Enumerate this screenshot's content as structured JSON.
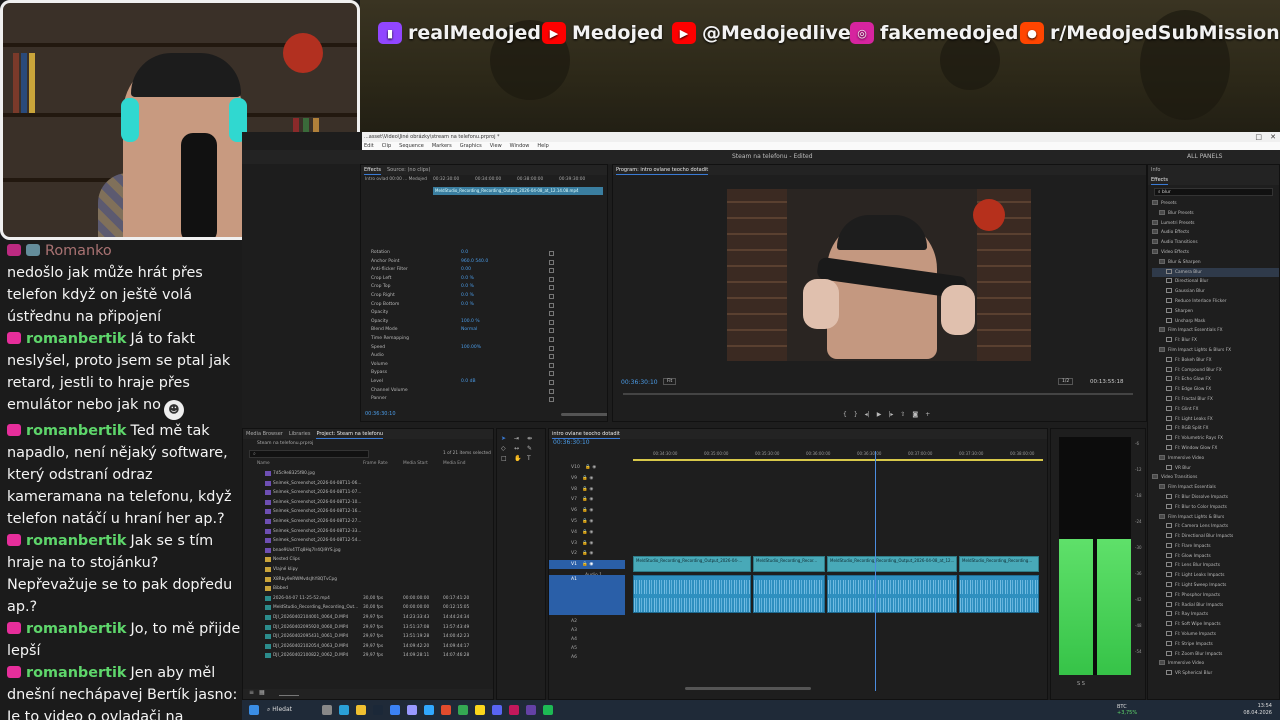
{
  "banner": {
    "socials": [
      {
        "platform": "twitch-icon",
        "label": "realMedojed",
        "color": "#9146ff"
      },
      {
        "platform": "youtube-icon",
        "label": "Medojed",
        "color": "#ff0000"
      },
      {
        "platform": "youtube-icon",
        "label": "@Medojedlive",
        "color": "#ff0000"
      },
      {
        "platform": "instagram-icon",
        "label": "fakemedojed",
        "color": "#d6249f"
      },
      {
        "platform": "reddit-icon",
        "label": "r/MedojedSubMissions",
        "color": "#ff4500"
      }
    ]
  },
  "chat": {
    "messages": [
      {
        "user": "",
        "text": "nedošlo jak může hrát přes telefon když on ještě volá ústřednu na připojení"
      },
      {
        "user": "romanbertik",
        "text": "Já to fakt neslyšel, proto jsem se ptal jak retard, jestli to hraje přes emulátor nebo jak no"
      },
      {
        "user": "romanbertik",
        "text": "Ted mě tak napadlo, není nějaký software, který odstraní odraz kameramana na telefonu, když telefon natáčí u hraní her ap.?"
      },
      {
        "user": "romanbertik",
        "text": "Jak se s tím hraje na to stojánku? Nepřevažuje se to pak dopředu ap.?"
      },
      {
        "user": "romanbertik",
        "text": "Jo, to mě přijde lepší"
      },
      {
        "user": "romanbertik",
        "text": "Jen aby měl dnešní nechápavej Bertík jasno: Je to video o ovladači na telefon, že?"
      }
    ],
    "top_partial_name": "Romanko",
    "emote_labels": [
      "☻",
      "☻"
    ]
  },
  "premiere": {
    "window_title": "...asset\\Video\\Jiné obrázky\\stream na telefonu.prproj *",
    "menu": [
      "Edit",
      "Clip",
      "Sequence",
      "Markers",
      "Graphics",
      "View",
      "Window",
      "Help"
    ],
    "project_title": "Steam na telefonu - Edited",
    "workspace_label": "ALL PANELS",
    "effect_controls": {
      "tabs": [
        "Effects",
        "Source: (no clips)"
      ],
      "source_label": "Intro ovlad 00:00 ... Medojed",
      "clip_label": "MeldStudio_Recording_Recording_Output_2026-04-08_at_12.14.08.mp4",
      "ruler": [
        "00:32:30:00",
        "00:34:00:00",
        "00:38:00:00",
        "00:39:30:00"
      ],
      "properties": [
        {
          "name": "Rotation",
          "value": "0.0"
        },
        {
          "name": "Anchor Point",
          "value": "960.0   540.0"
        },
        {
          "name": "Anti-flicker Filter",
          "value": "0.00"
        },
        {
          "name": "Crop Left",
          "value": "0.0 %"
        },
        {
          "name": "Crop Top",
          "value": "0.0 %"
        },
        {
          "name": "Crop Right",
          "value": "0.0 %"
        },
        {
          "name": "Crop Bottom",
          "value": "0.0 %"
        },
        {
          "name": "Opacity",
          "value": ""
        },
        {
          "name": "Opacity",
          "value": "100.0 %"
        },
        {
          "name": "Blend Mode",
          "value": "Normal"
        },
        {
          "name": "Time Remapping",
          "value": ""
        },
        {
          "name": "Speed",
          "value": "100.00%"
        },
        {
          "name": "Audio",
          "value": ""
        },
        {
          "name": "Volume",
          "value": ""
        },
        {
          "name": "Bypass",
          "value": ""
        },
        {
          "name": "Level",
          "value": "0.0 dB"
        },
        {
          "name": "Channel Volume",
          "value": ""
        },
        {
          "name": "Panner",
          "value": ""
        }
      ],
      "timecode": "00:36:30:10"
    },
    "program": {
      "tab": "Program: intro ovlane teocho dotadit",
      "timecode": "00:36:30:10",
      "zoom": "Fit",
      "resolution": "1/2",
      "duration": "00:13:55:18"
    },
    "project": {
      "tabs": [
        "Media Browser",
        "Libraries",
        "Project: Steam na telefonu"
      ],
      "file_label": "Steam na telefonu.prproj",
      "items_selected": "1 of 21 items selected",
      "columns": [
        "Name",
        "Frame Rate",
        "Media Start",
        "Media End"
      ],
      "rows": [
        {
          "name": "7d5c9e8325f80.jpg",
          "fps": "",
          "start": "",
          "end": ""
        },
        {
          "name": "Snímek_Screenshot_2026-04-08T11-06...",
          "fps": "",
          "start": "",
          "end": ""
        },
        {
          "name": "Snímek_Screenshot_2026-04-08T11-07...",
          "fps": "",
          "start": "",
          "end": ""
        },
        {
          "name": "Snímek_Screenshot_2026-04-08T12-10...",
          "fps": "",
          "start": "",
          "end": ""
        },
        {
          "name": "Snímek_Screenshot_2026-04-08T12-16...",
          "fps": "",
          "start": "",
          "end": ""
        },
        {
          "name": "Snímek_Screenshot_2026-04-08T12-27...",
          "fps": "",
          "start": "",
          "end": ""
        },
        {
          "name": "Snímek_Screenshot_2026-04-08T12-33...",
          "fps": "",
          "start": "",
          "end": ""
        },
        {
          "name": "Snímek_Screenshot_2026-04-08T12-54...",
          "fps": "",
          "start": "",
          "end": ""
        },
        {
          "name": "bnae9Ux4TTq8Hq7Ir4Qi9YS.jpg",
          "fps": "",
          "start": "",
          "end": ""
        },
        {
          "name": "Nested Clips",
          "fps": "",
          "start": "",
          "end": ""
        },
        {
          "name": "Vlajné klipy",
          "fps": "",
          "start": "",
          "end": ""
        },
        {
          "name": "X8Rby9eRWMvdsJhY8QTvCpg",
          "fps": "",
          "start": "",
          "end": ""
        },
        {
          "name": "Bibbed",
          "fps": "",
          "start": "",
          "end": ""
        },
        {
          "name": "2026-04-07 11-25-52.mp4",
          "fps": "30,00 fps",
          "start": "00:00:00:00",
          "end": "00:17:41:20"
        },
        {
          "name": "MeldStudio_Recording_Recording_Out...",
          "fps": "30,00 fps",
          "start": "00:00:00:00",
          "end": "00:12:15:05"
        },
        {
          "name": "DJI_20260402104001_0064_D.MP4",
          "fps": "29,97 fps",
          "start": "14:23:33:43",
          "end": "14:44:24:34"
        },
        {
          "name": "DJI_20260402095920_0060_D.MP4",
          "fps": "29,97 fps",
          "start": "13:51:37:08",
          "end": "13:57:43:49"
        },
        {
          "name": "DJI_20260402095431_0061_D.MP4",
          "fps": "29,97 fps",
          "start": "13:51:19:28",
          "end": "14:00:42:23"
        },
        {
          "name": "DJI_20260402102054_0063_D.MP4",
          "fps": "29,97 fps",
          "start": "14:09:42:20",
          "end": "14:09:44:17"
        },
        {
          "name": "DJI_20260402100822_0062_D.MP4",
          "fps": "29,97 fps",
          "start": "14:09:28:11",
          "end": "14:07:46:28"
        }
      ]
    },
    "timeline": {
      "tab": "intro ovlane teocho dotadit",
      "timecode": "00:36:30:10",
      "ruler": [
        "00:34:30:00",
        "00:35:00:00",
        "00:35:30:00",
        "00:36:00:00",
        "00:36:30:00",
        "00:37:00:00",
        "00:37:30:00",
        "00:38:00:00"
      ],
      "video_tracks": [
        "V10",
        "V9",
        "V8",
        "V7",
        "V6",
        "V5",
        "V4",
        "V3",
        "V2",
        "V1"
      ],
      "audio_tracks": [
        "A1",
        "A2",
        "A3",
        "A4",
        "A5",
        "A6"
      ],
      "audio_label": "Audio 1",
      "audio_gain": "7.0",
      "clips": [
        "MeldStudio_Recording_Recording_Output_2026-04-...",
        "MeldStudio_Recording_Recor...",
        "MeldStudio_Recording_Recording_Output_2026-04-08_at_12...",
        "MeldStudio_Recording_Recording..."
      ]
    },
    "meters": {
      "left_level": 0.57,
      "right_level": 0.57,
      "scale": [
        "-6",
        "-12",
        "-18",
        "-24",
        "-30",
        "-36",
        "-42",
        "-48",
        "-54"
      ],
      "footer": "S S"
    },
    "effects": {
      "tab": "Effects",
      "panel_title": "Info",
      "search": "blur",
      "items": [
        {
          "label": "Presets",
          "depth": 0
        },
        {
          "label": "Blur Presets",
          "depth": 1
        },
        {
          "label": "Lumetri Presets",
          "depth": 0
        },
        {
          "label": "Audio Effects",
          "depth": 0
        },
        {
          "label": "Audio Transitions",
          "depth": 0
        },
        {
          "label": "Video Effects",
          "depth": 0
        },
        {
          "label": "Blur & Sharpen",
          "depth": 1
        },
        {
          "label": "Camera Blur",
          "depth": 2
        },
        {
          "label": "Directional Blur",
          "depth": 2
        },
        {
          "label": "Gaussian Blur",
          "depth": 2
        },
        {
          "label": "Reduce Interlace Flicker",
          "depth": 2
        },
        {
          "label": "Sharpen",
          "depth": 2
        },
        {
          "label": "Unsharp Mask",
          "depth": 2
        },
        {
          "label": "Film Impact Essentials FX",
          "depth": 1
        },
        {
          "label": "FI: Blur FX",
          "depth": 2
        },
        {
          "label": "Film Impact Lights & Blurs FX",
          "depth": 1
        },
        {
          "label": "FI: Bokeh Blur FX",
          "depth": 2
        },
        {
          "label": "FI: Compound Blur FX",
          "depth": 2
        },
        {
          "label": "FI: Echo Glow FX",
          "depth": 2
        },
        {
          "label": "FI: Edge Glow FX",
          "depth": 2
        },
        {
          "label": "FI: Fractal Blur FX",
          "depth": 2
        },
        {
          "label": "FI: Glint FX",
          "depth": 2
        },
        {
          "label": "FI: Light Leaks FX",
          "depth": 2
        },
        {
          "label": "FI: RGB Split FX",
          "depth": 2
        },
        {
          "label": "FI: Volumetric Rays FX",
          "depth": 2
        },
        {
          "label": "FI: Window Glow FX",
          "depth": 2
        },
        {
          "label": "Immersive Video",
          "depth": 1
        },
        {
          "label": "VR Blur",
          "depth": 2
        },
        {
          "label": "Video Transitions",
          "depth": 0
        },
        {
          "label": "Film Impact Essentials",
          "depth": 1
        },
        {
          "label": "FI: Blur Dissolve Impacts",
          "depth": 2
        },
        {
          "label": "FI: Blur to Color Impacts",
          "depth": 2
        },
        {
          "label": "Film Impact Lights & Blurs",
          "depth": 1
        },
        {
          "label": "FI: Camera Lens Impacts",
          "depth": 2
        },
        {
          "label": "FI: Directional Blur Impacts",
          "depth": 2
        },
        {
          "label": "FI: Flare Impacts",
          "depth": 2
        },
        {
          "label": "FI: Glow Impacts",
          "depth": 2
        },
        {
          "label": "FI: Lens Blur Impacts",
          "depth": 2
        },
        {
          "label": "FI: Light Leaks Impacts",
          "depth": 2
        },
        {
          "label": "FI: Light Sweep Impacts",
          "depth": 2
        },
        {
          "label": "FI: Phosphor Impacts",
          "depth": 2
        },
        {
          "label": "FI: Radial Blur Impacts",
          "depth": 2
        },
        {
          "label": "FI: Ray Impacts",
          "depth": 2
        },
        {
          "label": "FI: Soft Wipe Impacts",
          "depth": 2
        },
        {
          "label": "FI: Volume Impacts",
          "depth": 2
        },
        {
          "label": "FI: Stripe Impacts",
          "depth": 2
        },
        {
          "label": "FI: Zoom Blur Impacts",
          "depth": 2
        },
        {
          "label": "Immersive Video",
          "depth": 1
        },
        {
          "label": "VR Spherical Blur",
          "depth": 2
        }
      ]
    }
  },
  "taskbar": {
    "search_label": "Hledat",
    "crypto_label": "BTC",
    "crypto_change": "+3,75%",
    "time": "13:54",
    "date": "08.04.2026"
  },
  "colors": {
    "accent": "#3a7bd5",
    "chat_user": "#5ed66b",
    "chat_badge": "#e62e9b",
    "clip_video": "#48a9b8",
    "clip_audio": "#2e8fbf"
  }
}
